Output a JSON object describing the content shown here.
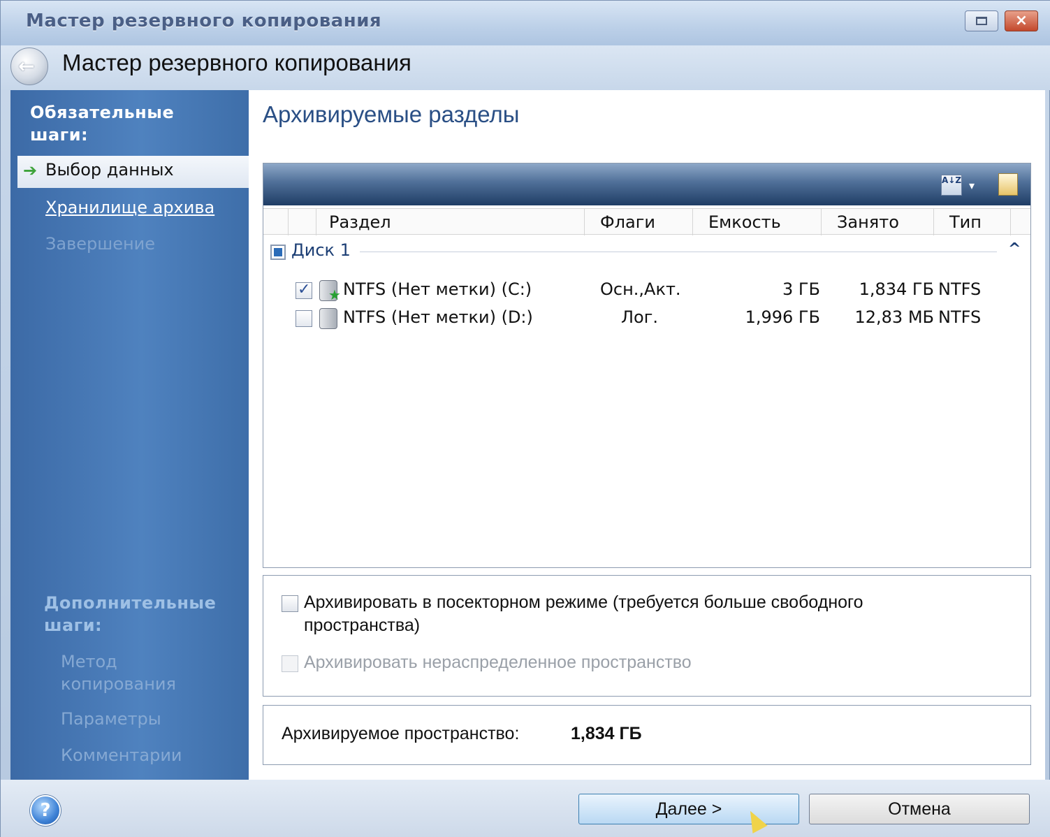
{
  "window": {
    "title": "Мастер резервного копирования",
    "close_glyph": "×"
  },
  "header": {
    "title": "Мастер резервного копирования",
    "back_glyph": "←"
  },
  "sidebar": {
    "required_heading": "Обязательные шаги:",
    "steps": [
      {
        "label": "Выбор данных",
        "state": "active"
      },
      {
        "label": "Хранилище архива",
        "state": "link"
      },
      {
        "label": "Завершение",
        "state": "disabled"
      }
    ],
    "optional_heading": "Дополнительные шаги:",
    "optional_steps": [
      {
        "label": "Метод копирования"
      },
      {
        "label": "Параметры"
      },
      {
        "label": "Комментарии"
      }
    ]
  },
  "main": {
    "title": "Архивируемые разделы",
    "toolbar": {
      "sort_glyph": "A↓Z",
      "dropdown_glyph": "▾"
    },
    "columns": [
      "Раздел",
      "Флаги",
      "Емкость",
      "Занято",
      "Тип"
    ],
    "group": {
      "label": "Диск 1",
      "caret": "^"
    },
    "rows": [
      {
        "checked": true,
        "name": "NTFS (Нет метки) (C:)",
        "flags": "Осн.,Акт.",
        "capacity": "3 ГБ",
        "used": "1,834 ГБ",
        "type": "NTFS"
      },
      {
        "checked": false,
        "name": "NTFS (Нет метки) (D:)",
        "flags": "Лог.",
        "capacity": "1,996 ГБ",
        "used": "12,83 МБ",
        "type": "NTFS"
      }
    ],
    "check_glyph": "✓",
    "options": [
      {
        "label": "Архивировать в посекторном режиме (требуется больше свободного пространства)",
        "line1": "Архивировать в посекторном режиме (требуется больше свободного",
        "line2": "пространства)",
        "checked": false,
        "enabled": true
      },
      {
        "label": "Архивировать нераспределенное пространство",
        "checked": false,
        "enabled": false
      }
    ],
    "space_label": "Архивируемое пространство:",
    "space_value": "1,834 ГБ"
  },
  "footer": {
    "help_glyph": "?",
    "next_label": "Далее >",
    "cancel_label": "Отмена"
  },
  "colors": {
    "sidebar": "#4f82bf",
    "title_text": "#2a4f85",
    "toolbar_dark": "#1f3d65"
  }
}
